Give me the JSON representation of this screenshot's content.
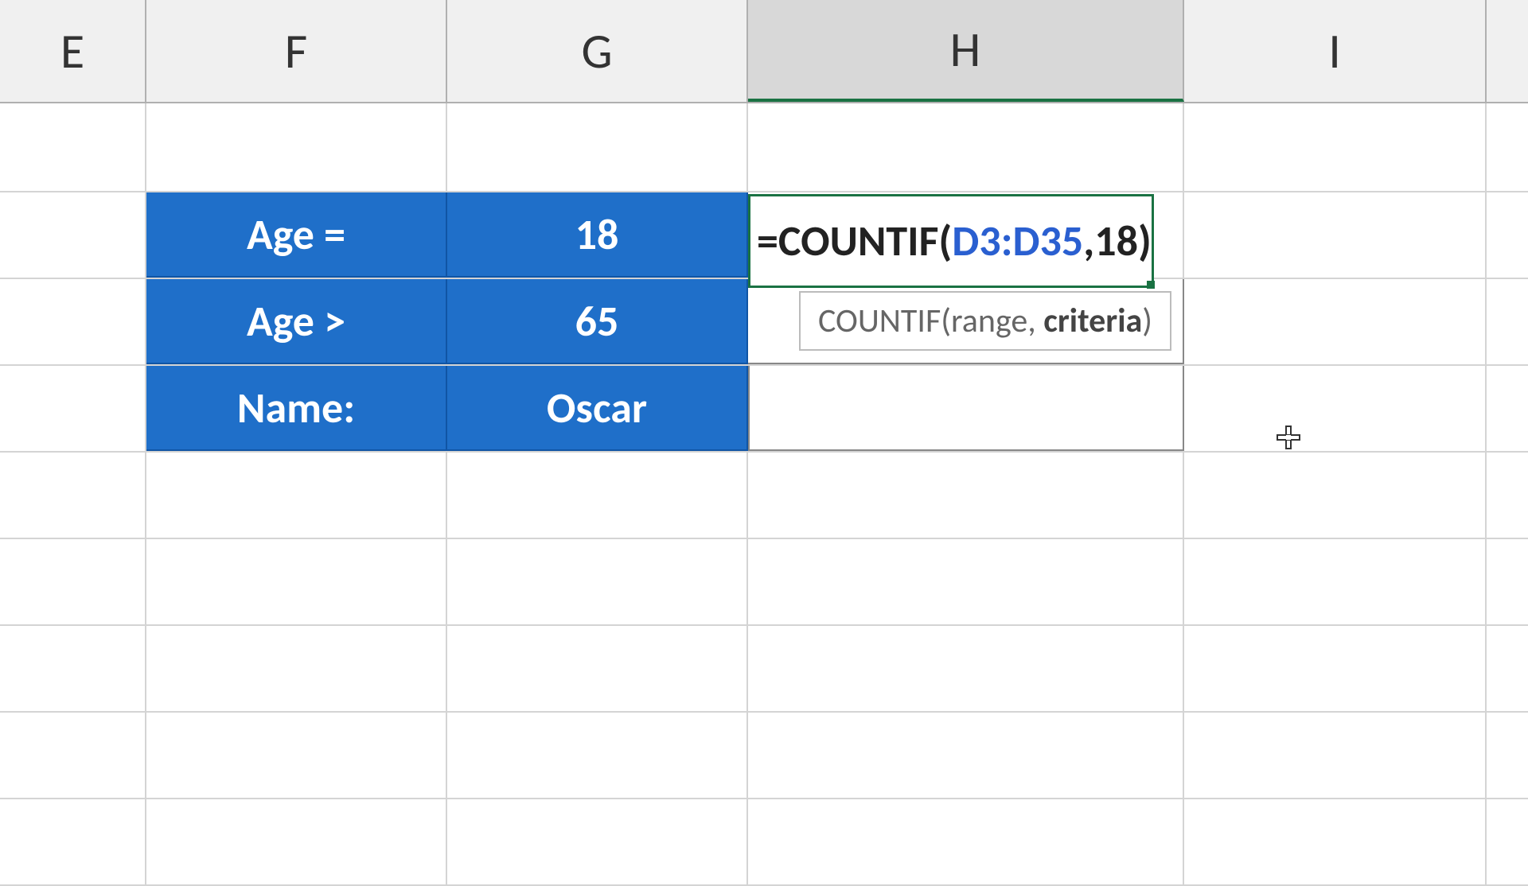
{
  "columns": {
    "E": "E",
    "F": "F",
    "G": "G",
    "H": "H",
    "I": "I"
  },
  "selected_column": "H",
  "table": {
    "rows": [
      {
        "label": "Age =",
        "value": "18"
      },
      {
        "label": "Age >",
        "value": "65"
      },
      {
        "label": "Name:",
        "value": "Oscar"
      }
    ]
  },
  "formula": {
    "prefix": "=",
    "function": "COUNTIF",
    "open": "(",
    "range": "D3:D35",
    "comma": ",",
    "criteria": "18",
    "close": ")"
  },
  "tooltip": {
    "fn": "COUNTIF",
    "open": "(",
    "arg1": "range",
    "sep": ", ",
    "arg2": "criteria",
    "close": ")"
  }
}
